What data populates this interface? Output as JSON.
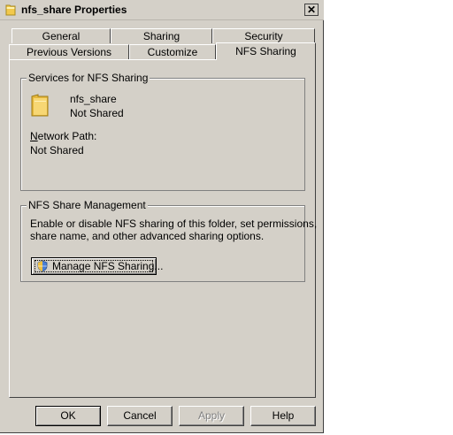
{
  "window": {
    "title": "nfs_share Properties",
    "close_glyph": "✕"
  },
  "tabs": {
    "row_top": [
      {
        "label": "General"
      },
      {
        "label": "Sharing"
      },
      {
        "label": "Security"
      }
    ],
    "row_bottom": [
      {
        "label": "Previous Versions"
      },
      {
        "label": "Customize"
      },
      {
        "label": "NFS Sharing"
      }
    ],
    "active": "NFS Sharing"
  },
  "services_group": {
    "legend": "Services for NFS Sharing",
    "share_name": "nfs_share",
    "share_status": "Not Shared",
    "network_path_label": "Network Path:",
    "network_path_value": "Not Shared"
  },
  "management_group": {
    "legend": "NFS Share Management",
    "description_line1": "Enable or disable NFS sharing of this folder, set permissions,",
    "description_line2": "share name, and other advanced sharing options.",
    "manage_button_label": "Manage NFS Sharing..."
  },
  "buttons": {
    "ok": "OK",
    "cancel": "Cancel",
    "apply": "Apply",
    "help": "Help"
  },
  "icons": {
    "title_icon": "folder-icon",
    "share_icon": "folder-icon",
    "manage_icon": "shield-icon"
  },
  "colors": {
    "dialog_bg": "#d4d0c8",
    "folder_yellow": "#f2c94c"
  }
}
